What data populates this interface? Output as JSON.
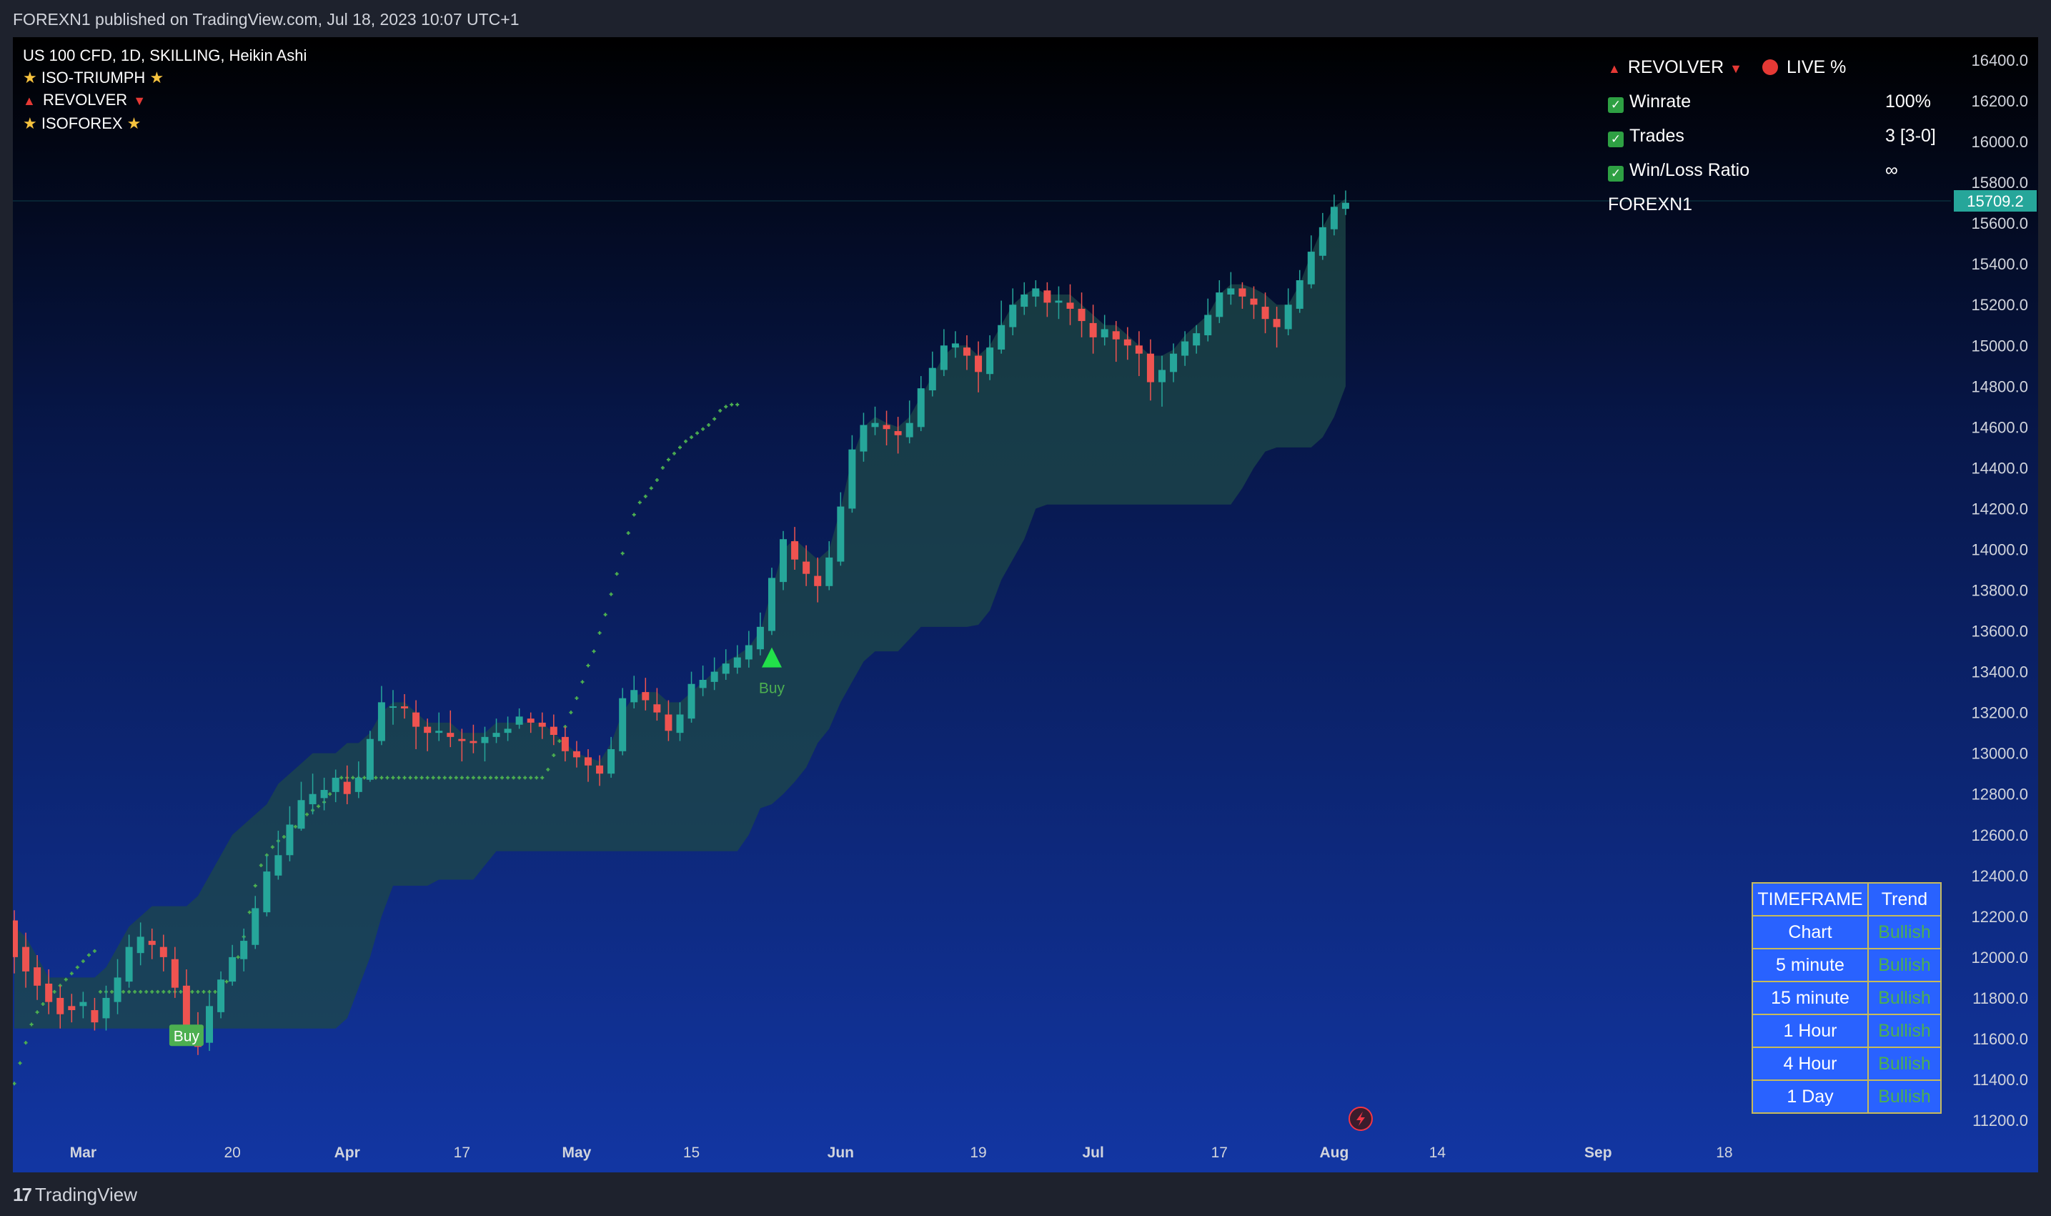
{
  "publisher_line": "FOREXN1 published on TradingView.com, Jul 18, 2023 10:07 UTC+1",
  "footer_logo": "TradingView",
  "legend": {
    "symbol": "US 100 CFD, 1D, SKILLING, Heikin Ashi",
    "ind1": "ISO-TRIUMPH",
    "ind2": "REVOLVER",
    "ind3": "ISOFOREX"
  },
  "stats": {
    "title": "REVOLVER",
    "live": "LIVE %",
    "rows": [
      {
        "label": "Winrate",
        "value": "100%"
      },
      {
        "label": "Trades",
        "value": "3 [3-0]"
      },
      {
        "label": "Win/Loss Ratio",
        "value": "∞"
      }
    ],
    "author": "FOREXN1"
  },
  "timeframe_table": {
    "header": [
      "TIMEFRAME",
      "Trend"
    ],
    "rows": [
      {
        "tf": "Chart",
        "trend": "Bullish"
      },
      {
        "tf": "5 minute",
        "trend": "Bullish"
      },
      {
        "tf": "15 minute",
        "trend": "Bullish"
      },
      {
        "tf": "1 Hour",
        "trend": "Bullish"
      },
      {
        "tf": "4 Hour",
        "trend": "Bullish"
      },
      {
        "tf": "1 Day",
        "trend": "Bullish"
      }
    ]
  },
  "colors": {
    "bull": "#26a69a",
    "bear": "#ef5350",
    "signal": "#4caf50",
    "cloud": "#1e4848",
    "price_tag": "#26a69a"
  },
  "chart_data": {
    "type": "candlestick",
    "style": "Heikin Ashi",
    "y_ticks": [
      16400,
      16200,
      16000,
      15800,
      15600,
      15400,
      15200,
      15000,
      14800,
      14600,
      14400,
      14200,
      14000,
      13800,
      13600,
      13400,
      13200,
      13000,
      12800,
      12600,
      12400,
      12200,
      12000,
      11800,
      11600,
      11400,
      11200
    ],
    "y_tick_labels": [
      "16400.0",
      "16200.0",
      "16000.0",
      "15800.0",
      "15600.0",
      "15400.0",
      "15200.0",
      "15000.0",
      "14800.0",
      "14600.0",
      "14400.0",
      "14200.0",
      "14000.0",
      "13800.0",
      "13600.0",
      "13400.0",
      "13200.0",
      "13000.0",
      "12800.0",
      "12600.0",
      "12400.0",
      "12200.0",
      "12000.0",
      "11800.0",
      "11600.0",
      "11400.0",
      "11200.0"
    ],
    "ylim": [
      11100,
      16500
    ],
    "x_ticks": [
      {
        "label": "Mar",
        "bold": true,
        "bar": 6
      },
      {
        "label": "20",
        "bold": false,
        "bar": 19
      },
      {
        "label": "Apr",
        "bold": true,
        "bar": 29
      },
      {
        "label": "17",
        "bold": false,
        "bar": 39
      },
      {
        "label": "May",
        "bold": true,
        "bar": 49
      },
      {
        "label": "15",
        "bold": false,
        "bar": 59
      },
      {
        "label": "Jun",
        "bold": true,
        "bar": 72
      },
      {
        "label": "19",
        "bold": false,
        "bar": 84
      },
      {
        "label": "Jul",
        "bold": true,
        "bar": 94
      },
      {
        "label": "17",
        "bold": false,
        "bar": 105
      },
      {
        "label": "Aug",
        "bold": true,
        "bar": 115
      },
      {
        "label": "14",
        "bold": false,
        "bar": 124
      },
      {
        "label": "Sep",
        "bold": true,
        "bar": 138
      },
      {
        "label": "18",
        "bold": false,
        "bar": 149
      }
    ],
    "last_price": 15709.2,
    "last_price_label": "15709.2",
    "candles": [
      [
        12180,
        12000,
        12230,
        11920
      ],
      [
        12050,
        11930,
        12120,
        11850
      ],
      [
        11950,
        11860,
        12010,
        11790
      ],
      [
        11870,
        11780,
        11940,
        11720
      ],
      [
        11800,
        11720,
        11860,
        11650
      ],
      [
        11760,
        11740,
        11820,
        11680
      ],
      [
        11760,
        11780,
        11830,
        11700
      ],
      [
        11740,
        11680,
        11800,
        11640
      ],
      [
        11700,
        11800,
        11860,
        11640
      ],
      [
        11780,
        11900,
        11990,
        11720
      ],
      [
        11880,
        12050,
        12110,
        11850
      ],
      [
        12020,
        12100,
        12170,
        11960
      ],
      [
        12080,
        12060,
        12140,
        11990
      ],
      [
        12050,
        12000,
        12110,
        11930
      ],
      [
        11990,
        11850,
        12050,
        11800
      ],
      [
        11860,
        11650,
        11940,
        11620
      ],
      [
        11660,
        11560,
        11730,
        11520
      ],
      [
        11580,
        11760,
        11820,
        11540
      ],
      [
        11730,
        11890,
        11930,
        11700
      ],
      [
        11880,
        12000,
        12060,
        11860
      ],
      [
        11990,
        12080,
        12140,
        11930
      ],
      [
        12060,
        12240,
        12300,
        12040
      ],
      [
        12220,
        12420,
        12500,
        12200
      ],
      [
        12400,
        12500,
        12620,
        12380
      ],
      [
        12500,
        12650,
        12740,
        12470
      ],
      [
        12630,
        12770,
        12860,
        12620
      ],
      [
        12750,
        12800,
        12900,
        12700
      ],
      [
        12780,
        12820,
        12880,
        12720
      ],
      [
        12810,
        12880,
        12920,
        12760
      ],
      [
        12860,
        12800,
        12940,
        12750
      ],
      [
        12810,
        12880,
        12960,
        12780
      ],
      [
        12870,
        13070,
        13110,
        12860
      ],
      [
        13060,
        13250,
        13330,
        13040
      ],
      [
        13230,
        13230,
        13310,
        13140
      ],
      [
        13230,
        13220,
        13290,
        13170
      ],
      [
        13200,
        13130,
        13260,
        13020
      ],
      [
        13130,
        13100,
        13170,
        13010
      ],
      [
        13100,
        13110,
        13200,
        13060
      ],
      [
        13100,
        13080,
        13210,
        13030
      ],
      [
        13070,
        13060,
        13120,
        12960
      ],
      [
        13060,
        13050,
        13140,
        13000
      ],
      [
        13050,
        13080,
        13130,
        12960
      ],
      [
        13080,
        13100,
        13170,
        13050
      ],
      [
        13100,
        13120,
        13180,
        13060
      ],
      [
        13140,
        13180,
        13220,
        13120
      ],
      [
        13170,
        13150,
        13200,
        13100
      ],
      [
        13150,
        13130,
        13200,
        13070
      ],
      [
        13130,
        13090,
        13190,
        13040
      ],
      [
        13080,
        13010,
        13130,
        12960
      ],
      [
        13010,
        12980,
        13060,
        12930
      ],
      [
        12980,
        12940,
        13020,
        12860
      ],
      [
        12940,
        12900,
        12990,
        12840
      ],
      [
        12900,
        13020,
        13080,
        12880
      ],
      [
        13010,
        13270,
        13320,
        12990
      ],
      [
        13250,
        13310,
        13380,
        13220
      ],
      [
        13300,
        13260,
        13370,
        13210
      ],
      [
        13240,
        13200,
        13320,
        13160
      ],
      [
        13190,
        13110,
        13260,
        13060
      ],
      [
        13100,
        13190,
        13250,
        13060
      ],
      [
        13170,
        13340,
        13400,
        13150
      ],
      [
        13320,
        13360,
        13430,
        13280
      ],
      [
        13350,
        13400,
        13470,
        13310
      ],
      [
        13390,
        13440,
        13510,
        13360
      ],
      [
        13420,
        13470,
        13530,
        13390
      ],
      [
        13460,
        13530,
        13600,
        13420
      ],
      [
        13510,
        13620,
        13690,
        13480
      ],
      [
        13600,
        13860,
        13910,
        13580
      ],
      [
        13840,
        14050,
        14090,
        13800
      ],
      [
        14040,
        13950,
        14110,
        13900
      ],
      [
        13940,
        13880,
        14020,
        13820
      ],
      [
        13870,
        13820,
        13960,
        13740
      ],
      [
        13820,
        13960,
        14040,
        13800
      ],
      [
        13940,
        14210,
        14280,
        13920
      ],
      [
        14200,
        14490,
        14560,
        14180
      ],
      [
        14480,
        14610,
        14670,
        14430
      ],
      [
        14600,
        14620,
        14700,
        14560
      ],
      [
        14610,
        14590,
        14680,
        14510
      ],
      [
        14580,
        14560,
        14650,
        14470
      ],
      [
        14550,
        14620,
        14730,
        14520
      ],
      [
        14600,
        14790,
        14850,
        14580
      ],
      [
        14780,
        14890,
        14970,
        14750
      ],
      [
        14880,
        15000,
        15080,
        14850
      ],
      [
        14990,
        15010,
        15070,
        14940
      ],
      [
        14990,
        14950,
        15050,
        14880
      ],
      [
        14950,
        14870,
        15020,
        14770
      ],
      [
        14860,
        14990,
        15050,
        14830
      ],
      [
        14980,
        15100,
        15220,
        14960
      ],
      [
        15090,
        15200,
        15280,
        15050
      ],
      [
        15190,
        15250,
        15310,
        15150
      ],
      [
        15240,
        15280,
        15320,
        15190
      ],
      [
        15270,
        15210,
        15310,
        15140
      ],
      [
        15210,
        15220,
        15290,
        15130
      ],
      [
        15210,
        15180,
        15300,
        15100
      ],
      [
        15180,
        15120,
        15260,
        15040
      ],
      [
        15110,
        15040,
        15200,
        14960
      ],
      [
        15040,
        15080,
        15150,
        15000
      ],
      [
        15070,
        15030,
        15120,
        14920
      ],
      [
        15030,
        15000,
        15090,
        14930
      ],
      [
        15000,
        14960,
        15070,
        14850
      ],
      [
        14960,
        14820,
        15030,
        14730
      ],
      [
        14820,
        14880,
        14950,
        14700
      ],
      [
        14870,
        14960,
        15010,
        14820
      ],
      [
        14950,
        15020,
        15070,
        14900
      ],
      [
        15000,
        15060,
        15100,
        14960
      ],
      [
        15050,
        15150,
        15230,
        15020
      ],
      [
        15140,
        15260,
        15320,
        15110
      ],
      [
        15250,
        15280,
        15360,
        15200
      ],
      [
        15280,
        15240,
        15310,
        15180
      ],
      [
        15230,
        15200,
        15290,
        15130
      ],
      [
        15190,
        15130,
        15260,
        15060
      ],
      [
        15130,
        15090,
        15190,
        14990
      ],
      [
        15080,
        15200,
        15280,
        15050
      ],
      [
        15180,
        15320,
        15370,
        15160
      ],
      [
        15300,
        15460,
        15540,
        15280
      ],
      [
        15440,
        15580,
        15650,
        15420
      ],
      [
        15570,
        15680,
        15740,
        15540
      ],
      [
        15670,
        15700,
        15760,
        15640
      ]
    ],
    "cloud_upper": [
      12150,
      12100,
      12000,
      11900,
      11900,
      11900,
      11900,
      11900,
      11950,
      12050,
      12150,
      12200,
      12250,
      12250,
      12250,
      12250,
      12300,
      12400,
      12500,
      12600,
      12650,
      12700,
      12750,
      12850,
      12900,
      12950,
      13000,
      13000,
      13000,
      13050,
      13050,
      13100,
      13200,
      13250,
      13250,
      13200,
      13150,
      13150,
      13150,
      13100,
      13100,
      13100,
      13150,
      13150,
      13150,
      13150,
      13150,
      13100,
      13050,
      13000,
      12980,
      12960,
      13050,
      13200,
      13280,
      13300,
      13300,
      13250,
      13250,
      13300,
      13350,
      13400,
      13450,
      13480,
      13520,
      13600,
      13800,
      14000,
      14050,
      14000,
      13950,
      14000,
      14200,
      14450,
      14600,
      14650,
      14620,
      14600,
      14650,
      14750,
      14850,
      14950,
      15000,
      15000,
      14950,
      15000,
      15100,
      15200,
      15250,
      15280,
      15250,
      15250,
      15250,
      15200,
      15150,
      15100,
      15100,
      15050,
      15000,
      14950,
      14950,
      14980,
      15050,
      15100,
      15150,
      15250,
      15300,
      15300,
      15280,
      15250,
      15200,
      15200,
      15300,
      15450,
      15580,
      15680,
      15720
    ],
    "cloud_lower": [
      11650,
      11650,
      11650,
      11650,
      11650,
      11650,
      11650,
      11650,
      11650,
      11650,
      11650,
      11650,
      11650,
      11650,
      11650,
      11650,
      11650,
      11650,
      11650,
      11650,
      11650,
      11650,
      11650,
      11650,
      11650,
      11650,
      11650,
      11650,
      11650,
      11700,
      11850,
      12000,
      12200,
      12350,
      12350,
      12350,
      12350,
      12380,
      12380,
      12380,
      12380,
      12450,
      12520,
      12520,
      12520,
      12520,
      12520,
      12520,
      12520,
      12520,
      12520,
      12520,
      12520,
      12520,
      12520,
      12520,
      12520,
      12520,
      12520,
      12520,
      12520,
      12520,
      12520,
      12520,
      12600,
      12730,
      12750,
      12800,
      12860,
      12930,
      13050,
      13120,
      13250,
      13350,
      13450,
      13500,
      13500,
      13500,
      13560,
      13620,
      13620,
      13620,
      13620,
      13620,
      13630,
      13700,
      13850,
      13950,
      14050,
      14200,
      14220,
      14220,
      14220,
      14220,
      14220,
      14220,
      14220,
      14220,
      14220,
      14220,
      14220,
      14220,
      14220,
      14220,
      14220,
      14220,
      14220,
      14300,
      14400,
      14480,
      14500,
      14500,
      14500,
      14500,
      14550,
      14650,
      14800
    ],
    "trailing_stop": [
      11380,
      11480,
      11580,
      11670,
      11730,
      11770,
      11800,
      11830,
      11860,
      11890,
      11920,
      11950,
      11980,
      12010,
      12030,
      11830,
      11830,
      11830,
      11830,
      11830,
      11830,
      11830,
      11830,
      11830,
      11830,
      11830,
      11830,
      11830,
      11830,
      11830,
      11830,
      11830,
      11830,
      11830,
      11830,
      11830,
      11850,
      11880,
      11930,
      12000,
      12100,
      12220,
      12350,
      12450,
      12500,
      12540,
      12570,
      12590,
      12600,
      12640,
      12680,
      12700,
      12720,
      12740,
      12760,
      12800,
      12850,
      12880,
      12880,
      12880,
      12880,
      12880,
      12880,
      12880,
      12880,
      12880,
      12880,
      12880,
      12880,
      12880,
      12880,
      12880,
      12880,
      12880,
      12880,
      12880,
      12880,
      12880,
      12880,
      12880,
      12880,
      12880,
      12880,
      12880,
      12880,
      12880,
      12880,
      12880,
      12880,
      12880,
      12880,
      12880,
      12880,
      12920,
      12990,
      13060,
      13130,
      13200,
      13270,
      13350,
      13430,
      13500,
      13590,
      13680,
      13780,
      13880,
      13980,
      14080,
      14170,
      14230,
      14260,
      14300,
      14340,
      14400,
      14440,
      14470,
      14500,
      14530,
      14550,
      14570,
      14590,
      14610,
      14640,
      14680,
      14700,
      14710,
      14710
    ],
    "trailing_stop_start_bar": -22,
    "signals": [
      {
        "type": "box",
        "label": "Buy",
        "bar": 15,
        "price": 11690
      },
      {
        "type": "arrow",
        "label": "Buy",
        "bar": 66,
        "price": 13470
      }
    ]
  }
}
